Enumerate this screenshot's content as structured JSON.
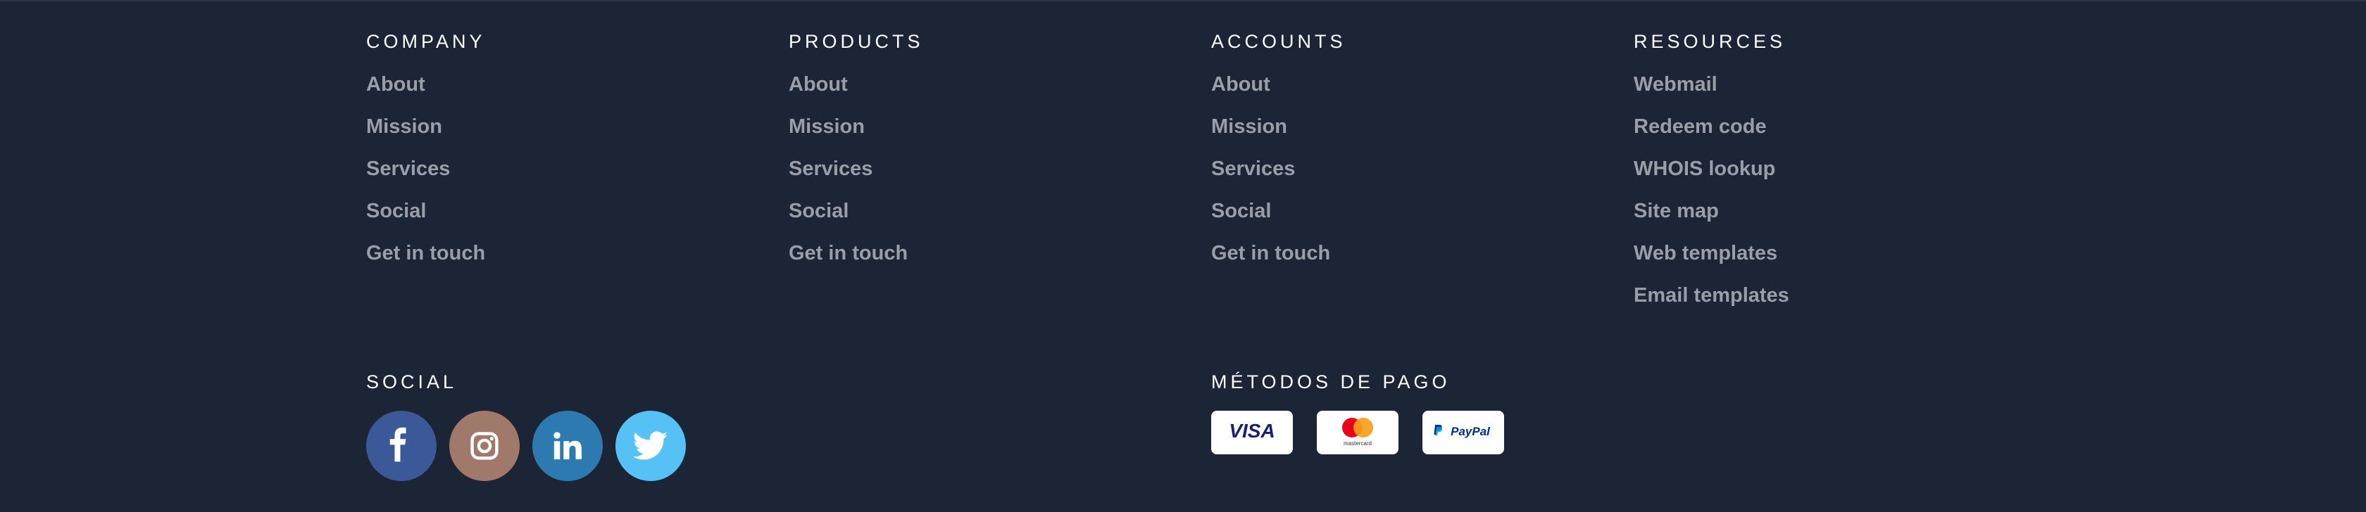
{
  "columns": [
    {
      "title": "COMPANY",
      "links": [
        "About",
        "Mission",
        "Services",
        "Social",
        "Get in touch"
      ]
    },
    {
      "title": "PRODUCTS",
      "links": [
        "About",
        "Mission",
        "Services",
        "Social",
        "Get in touch"
      ]
    },
    {
      "title": "ACCOUNTS",
      "links": [
        "About",
        "Mission",
        "Services",
        "Social",
        "Get in touch"
      ]
    },
    {
      "title": "RESOURCES",
      "links": [
        "Webmail",
        "Redeem code",
        "WHOIS lookup",
        "Site map",
        "Web templates",
        "Email templates"
      ]
    }
  ],
  "social": {
    "title": "SOCIAL",
    "icons": [
      {
        "name": "facebook-icon",
        "color": "#3b5998"
      },
      {
        "name": "instagram-icon",
        "color": "#a1796a"
      },
      {
        "name": "linkedin-icon",
        "color": "#2d7ab0"
      },
      {
        "name": "twitter-icon",
        "color": "#55c1f5"
      }
    ]
  },
  "payments": {
    "title": "MÉTODOS DE PAGO",
    "cards": [
      {
        "name": "visa-icon",
        "label": "VISA",
        "color": "#1a1f71"
      },
      {
        "name": "mastercard-icon",
        "label": "mastercard",
        "colors": [
          "#eb001b",
          "#f79e1b"
        ]
      },
      {
        "name": "paypal-icon",
        "label": "PayPal",
        "colors": [
          "#003087",
          "#009cde"
        ]
      }
    ]
  },
  "colors": {
    "background": "#1b2535",
    "heading": "#ffffff",
    "link": "#9a9ea6"
  }
}
